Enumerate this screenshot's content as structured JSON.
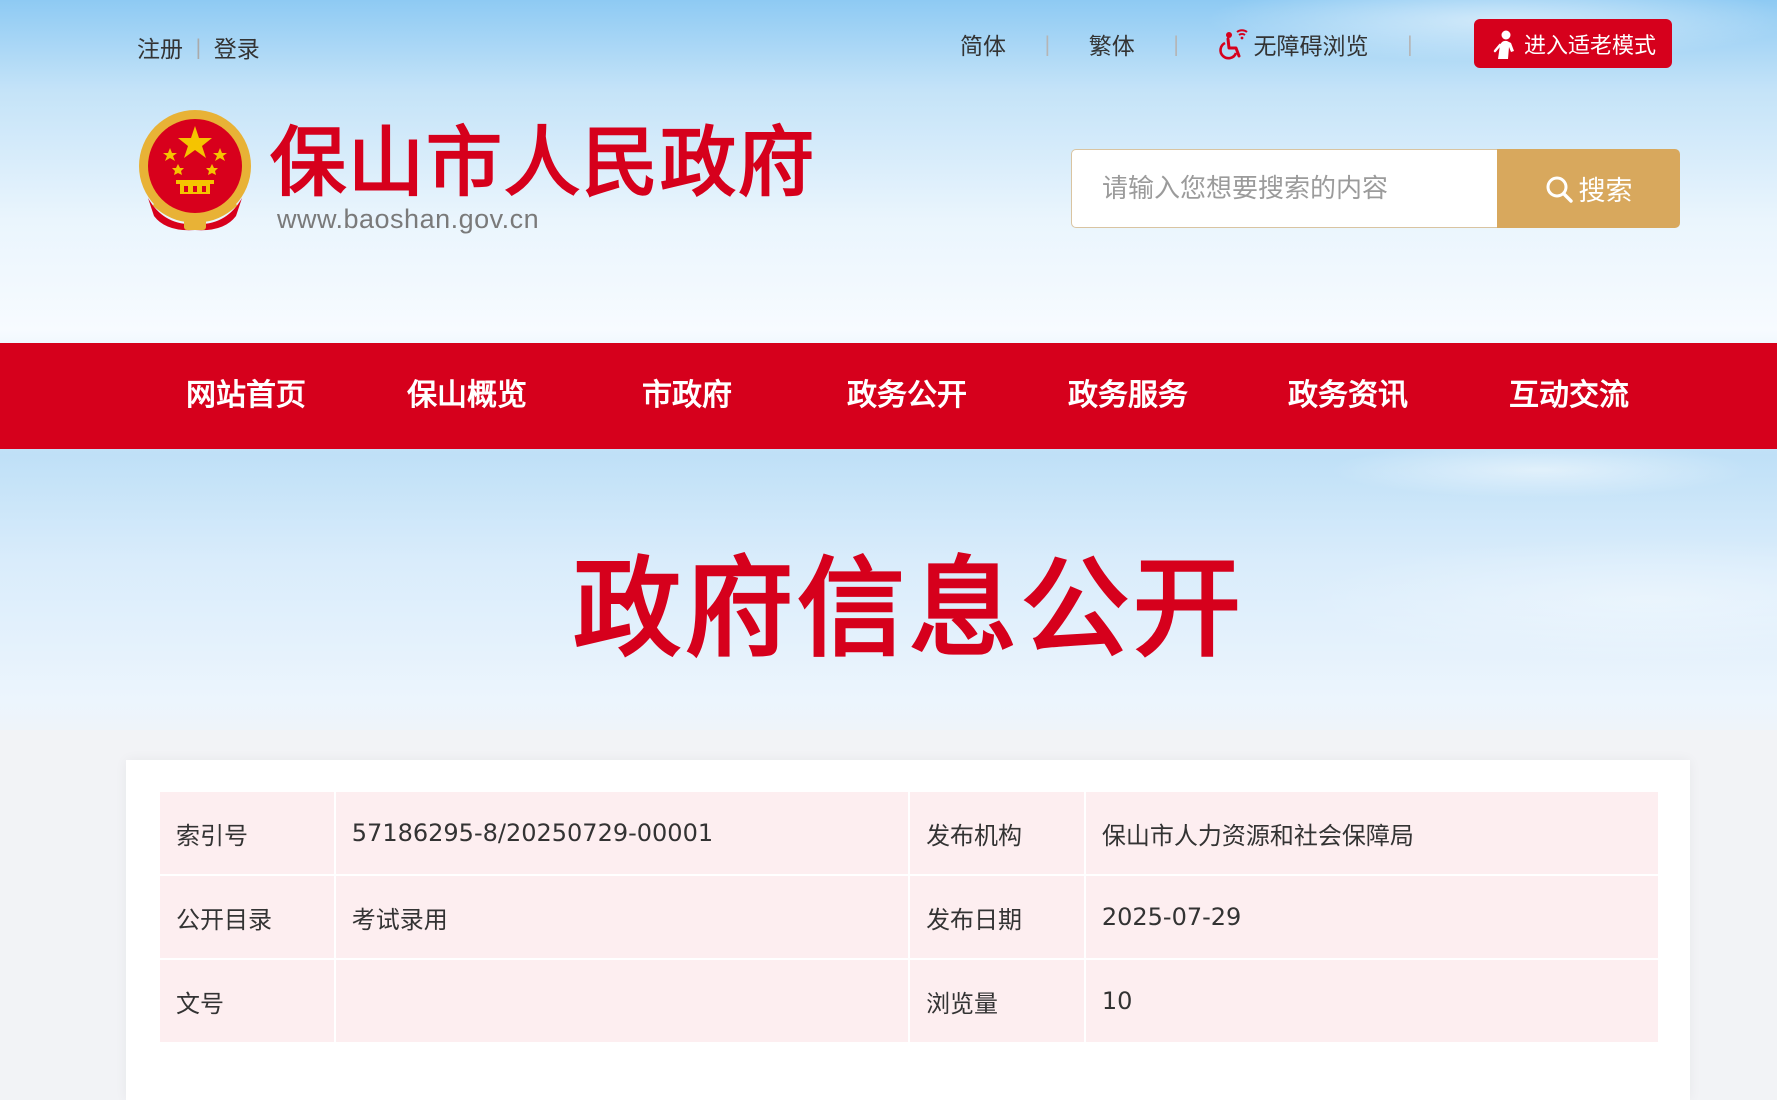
{
  "top_links": {
    "register": "注册",
    "separator": "|",
    "login": "登录"
  },
  "top_right": {
    "simplified": "简体",
    "traditional": "繁体",
    "accessibility": "无障碍浏览",
    "separator": "|",
    "elder_mode": "进入适老模式"
  },
  "header": {
    "site_name": "保山市人民政府",
    "site_url": "www.baoshan.gov.cn"
  },
  "search": {
    "placeholder": "请输入您想要搜索的内容",
    "button_label": "搜索"
  },
  "nav": [
    {
      "label": "网站首页"
    },
    {
      "label": "保山概览"
    },
    {
      "label": "市政府"
    },
    {
      "label": "政务公开"
    },
    {
      "label": "政务服务"
    },
    {
      "label": "政务资讯"
    },
    {
      "label": "互动交流"
    }
  ],
  "banner": {
    "title": "政府信息公开"
  },
  "info_table": {
    "rows": [
      {
        "label1": "索引号",
        "value1": "57186295-8/20250729-00001",
        "label2": "发布机构",
        "value2": "保山市人力资源和社会保障局"
      },
      {
        "label1": "公开目录",
        "value1": "考试录用",
        "label2": "发布日期",
        "value2": "2025-07-29"
      },
      {
        "label1": "文号",
        "value1": "",
        "label2": "浏览量",
        "value2": "10"
      }
    ]
  },
  "colors": {
    "brand_red": "#d6001c",
    "search_gold": "#d8a85d",
    "table_pink": "#fdeef0"
  },
  "icons": {
    "accessibility": "wheelchair-icon",
    "elder": "elder-person-icon",
    "search": "magnifier-icon",
    "emblem": "national-emblem-icon"
  }
}
